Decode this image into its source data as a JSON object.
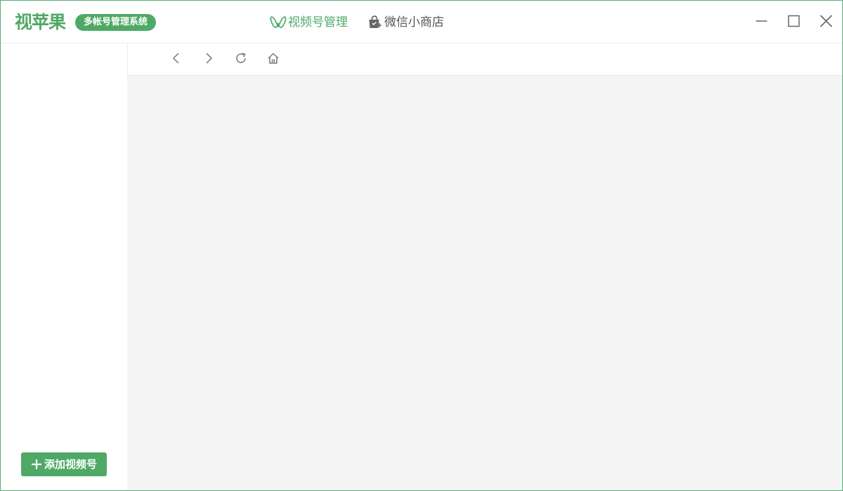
{
  "app": {
    "logo_text": "视苹果",
    "logo_badge": "多帐号管理系统"
  },
  "nav": {
    "items": [
      {
        "label": "视频号管理",
        "icon": "channels-butterfly-icon",
        "active": true
      },
      {
        "label": "微信小商店",
        "icon": "shopping-bag-icon",
        "active": false
      }
    ]
  },
  "window_controls": {
    "minimize": "minimize-icon",
    "maximize": "maximize-icon",
    "close": "close-icon"
  },
  "toolbar": {
    "back": "chevron-left-icon",
    "forward": "chevron-right-icon",
    "refresh": "refresh-icon",
    "home": "home-icon"
  },
  "sidebar": {
    "add_button_label": "添加视频号",
    "add_button_icon": "plus-icon"
  },
  "colors": {
    "accent": "#4fa966",
    "border": "#55ad6f",
    "content_bg": "#f4f4f4"
  }
}
